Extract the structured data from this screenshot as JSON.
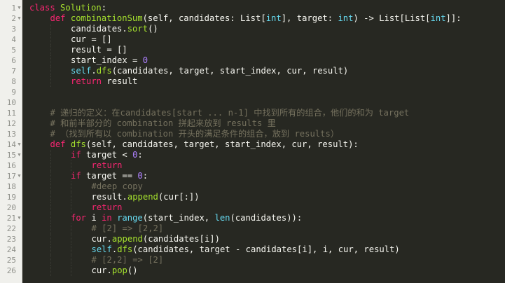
{
  "editor": {
    "language": "python",
    "theme_colors": {
      "background": "#272822",
      "gutter_background": "#f0f0ec",
      "text": "#f8f8f2",
      "keyword": "#f92672",
      "function": "#a6e22e",
      "builtin": "#66d9ef",
      "number": "#ae81ff",
      "comment": "#75715e"
    },
    "lines": [
      {
        "n": "1",
        "fold": true,
        "indent": 0,
        "tokens": [
          [
            "k",
            "class"
          ],
          [
            "t",
            " "
          ],
          [
            "f",
            "Solution"
          ],
          [
            "t",
            ":"
          ]
        ]
      },
      {
        "n": "2",
        "fold": true,
        "indent": 1,
        "tokens": [
          [
            "k",
            "def"
          ],
          [
            "t",
            " "
          ],
          [
            "f",
            "combinationSum"
          ],
          [
            "t",
            "(self, candidates: List["
          ],
          [
            "b",
            "int"
          ],
          [
            "t",
            "], target: "
          ],
          [
            "b",
            "int"
          ],
          [
            "t",
            ") -> List[List["
          ],
          [
            "b",
            "int"
          ],
          [
            "t",
            "]]:"
          ]
        ]
      },
      {
        "n": "3",
        "fold": false,
        "indent": 2,
        "tokens": [
          [
            "t",
            "candidates."
          ],
          [
            "f",
            "sort"
          ],
          [
            "t",
            "()"
          ]
        ]
      },
      {
        "n": "4",
        "fold": false,
        "indent": 2,
        "tokens": [
          [
            "t",
            "cur = []"
          ]
        ]
      },
      {
        "n": "5",
        "fold": false,
        "indent": 2,
        "tokens": [
          [
            "t",
            "result = []"
          ]
        ]
      },
      {
        "n": "6",
        "fold": false,
        "indent": 2,
        "tokens": [
          [
            "t",
            "start_index = "
          ],
          [
            "n",
            "0"
          ]
        ]
      },
      {
        "n": "7",
        "fold": false,
        "indent": 2,
        "tokens": [
          [
            "b",
            "self"
          ],
          [
            "t",
            "."
          ],
          [
            "f",
            "dfs"
          ],
          [
            "t",
            "(candidates, target, start_index, cur, result)"
          ]
        ]
      },
      {
        "n": "8",
        "fold": false,
        "indent": 2,
        "tokens": [
          [
            "k",
            "return"
          ],
          [
            "t",
            " result"
          ]
        ]
      },
      {
        "n": "9",
        "fold": false,
        "indent": 0,
        "tokens": []
      },
      {
        "n": "10",
        "fold": false,
        "indent": 0,
        "tokens": []
      },
      {
        "n": "11",
        "fold": false,
        "indent": 1,
        "tokens": [
          [
            "c",
            "# 递归的定义：在candidates[start ... n-1] 中找到所有的组合，他们的和为 target"
          ]
        ]
      },
      {
        "n": "12",
        "fold": false,
        "indent": 1,
        "tokens": [
          [
            "c",
            "# 和前半部分的 combination 拼起来放到 results 里"
          ]
        ]
      },
      {
        "n": "13",
        "fold": false,
        "indent": 1,
        "tokens": [
          [
            "c",
            "# （找到所有以 combination 开头的满足条件的组合，放到 results）"
          ]
        ]
      },
      {
        "n": "14",
        "fold": true,
        "indent": 1,
        "tokens": [
          [
            "k",
            "def"
          ],
          [
            "t",
            " "
          ],
          [
            "f",
            "dfs"
          ],
          [
            "t",
            "(self, candidates, target, start_index, cur, result):"
          ]
        ]
      },
      {
        "n": "15",
        "fold": true,
        "indent": 2,
        "tokens": [
          [
            "k",
            "if"
          ],
          [
            "t",
            " target < "
          ],
          [
            "n",
            "0"
          ],
          [
            "t",
            ":"
          ]
        ]
      },
      {
        "n": "16",
        "fold": false,
        "indent": 3,
        "tokens": [
          [
            "k",
            "return"
          ]
        ]
      },
      {
        "n": "17",
        "fold": true,
        "indent": 2,
        "tokens": [
          [
            "k",
            "if"
          ],
          [
            "t",
            " target == "
          ],
          [
            "n",
            "0"
          ],
          [
            "t",
            ":"
          ]
        ]
      },
      {
        "n": "18",
        "fold": false,
        "indent": 3,
        "tokens": [
          [
            "c",
            "#deep copy"
          ]
        ]
      },
      {
        "n": "19",
        "fold": false,
        "indent": 3,
        "tokens": [
          [
            "t",
            "result."
          ],
          [
            "f",
            "append"
          ],
          [
            "t",
            "(cur[:])"
          ]
        ]
      },
      {
        "n": "20",
        "fold": false,
        "indent": 3,
        "tokens": [
          [
            "k",
            "return"
          ]
        ]
      },
      {
        "n": "21",
        "fold": true,
        "indent": 2,
        "tokens": [
          [
            "k",
            "for"
          ],
          [
            "t",
            " i "
          ],
          [
            "k",
            "in"
          ],
          [
            "t",
            " "
          ],
          [
            "b",
            "range"
          ],
          [
            "t",
            "(start_index, "
          ],
          [
            "b",
            "len"
          ],
          [
            "t",
            "(candidates)):"
          ]
        ]
      },
      {
        "n": "22",
        "fold": false,
        "indent": 3,
        "tokens": [
          [
            "c",
            "# [2] => [2,2]"
          ]
        ]
      },
      {
        "n": "23",
        "fold": false,
        "indent": 3,
        "tokens": [
          [
            "t",
            "cur."
          ],
          [
            "f",
            "append"
          ],
          [
            "t",
            "(candidates[i])"
          ]
        ]
      },
      {
        "n": "24",
        "fold": false,
        "indent": 3,
        "tokens": [
          [
            "b",
            "self"
          ],
          [
            "t",
            "."
          ],
          [
            "f",
            "dfs"
          ],
          [
            "t",
            "(candidates, target - candidates[i], i, cur, result)"
          ]
        ]
      },
      {
        "n": "25",
        "fold": false,
        "indent": 3,
        "tokens": [
          [
            "c",
            "# [2,2] => [2]"
          ]
        ]
      },
      {
        "n": "26",
        "fold": false,
        "indent": 3,
        "tokens": [
          [
            "t",
            "cur."
          ],
          [
            "f",
            "pop"
          ],
          [
            "t",
            "()"
          ]
        ]
      }
    ]
  }
}
